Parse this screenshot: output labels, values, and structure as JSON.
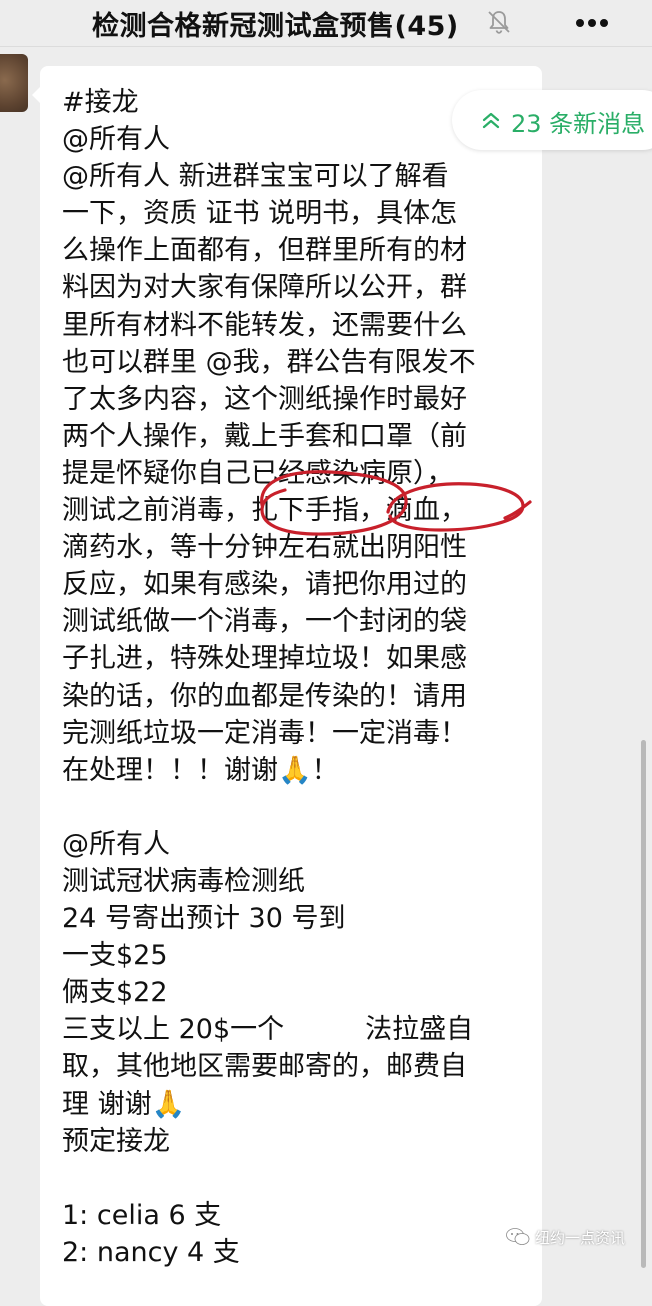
{
  "header": {
    "title": "检测合格新冠测试盒预售(45)"
  },
  "new_messages": {
    "label": "23 条新消息"
  },
  "message": {
    "lines": [
      "#接龙",
      "@所有人",
      "@所有人 新进群宝宝可以了解看",
      "一下，资质 证书 说明书，具体怎",
      "么操作上面都有，但群里所有的材",
      "料因为对大家有保障所以公开，群",
      "里所有材料不能转发，还需要什么",
      "也可以群里 @我，群公告有限发不",
      "了太多内容，这个测纸操作时最好",
      "两个人操作，戴上手套和口罩（前",
      "提是怀疑你自己已经感染病原），",
      "测试之前消毒，扎下手指，滴血，",
      "滴药水，等十分钟左右就出阴阳性",
      "反应，如果有感染，请把你用过的",
      "测试纸做一个消毒，一个封闭的袋",
      "子扎进，特殊处理掉垃圾！如果感",
      "染的话，你的血都是传染的！请用",
      "完测纸垃圾一定消毒！一定消毒！",
      "在处理！！！谢谢🙏！",
      "",
      "@所有人",
      "测试冠状病毒检测纸",
      "24 号寄出预计 30 号到",
      "一支$25",
      "俩支$22",
      "三支以上 20$一个　　　法拉盛自",
      "取，其他地区需要邮寄的，邮费自",
      "理 谢谢🙏",
      "预定接龙",
      "",
      "1: celia 6 支",
      "2: nancy 4 支"
    ]
  },
  "watermark": {
    "text": "纽约一点资讯"
  },
  "colors": {
    "background": "#ededed",
    "bubble": "#ffffff",
    "accent_green": "#2aae67",
    "annotation_red": "#c8202b"
  },
  "icons": {
    "mute": "bell-mute-icon",
    "more": "more-dots-icon",
    "new_messages": "double-chevron-up-icon",
    "watermark": "wechat-logo-icon"
  }
}
